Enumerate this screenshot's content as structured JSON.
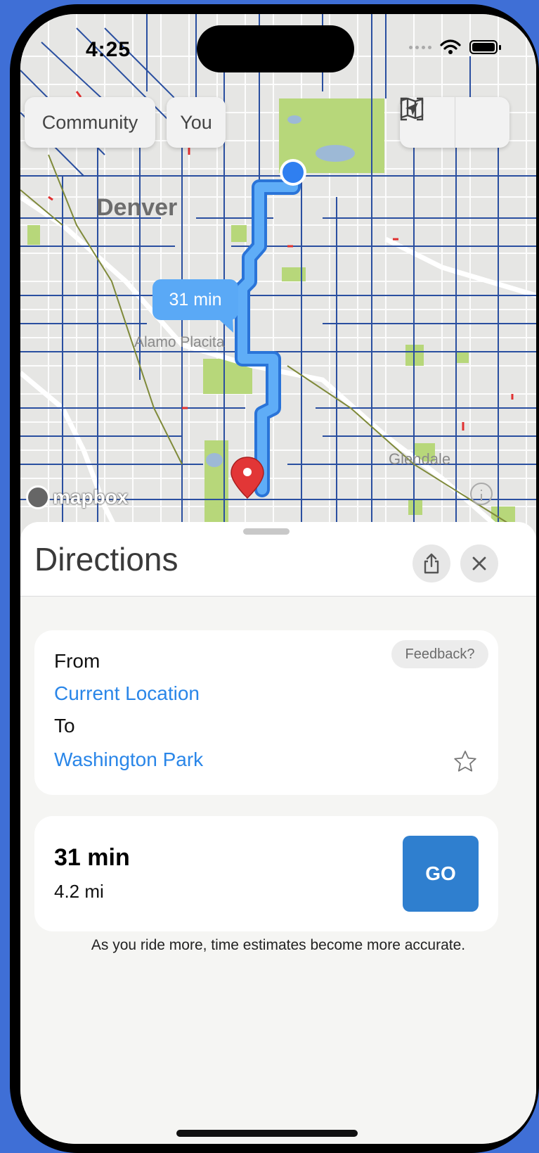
{
  "status": {
    "time": "4:25"
  },
  "map": {
    "community_label": "Community",
    "you_label": "You",
    "route_time": "31 min",
    "place_denver": "Denver",
    "place_alamo": "Alamo Placita",
    "place_glendale": "Glendale",
    "mapbox": "mapbox",
    "route_color": "#4a9cf5",
    "road_color": "#2a4fa0"
  },
  "sheet": {
    "title": "Directions",
    "from_label": "From",
    "from_value": "Current Location",
    "to_label": "To",
    "to_value": "Washington Park",
    "feedback": "Feedback?",
    "duration": "31 min",
    "distance": "4.2 mi",
    "go_label": "GO",
    "hint": "As you ride more, time estimates become more accurate."
  },
  "colors": {
    "accent": "#2a86e8",
    "go": "#2f7fcf"
  }
}
